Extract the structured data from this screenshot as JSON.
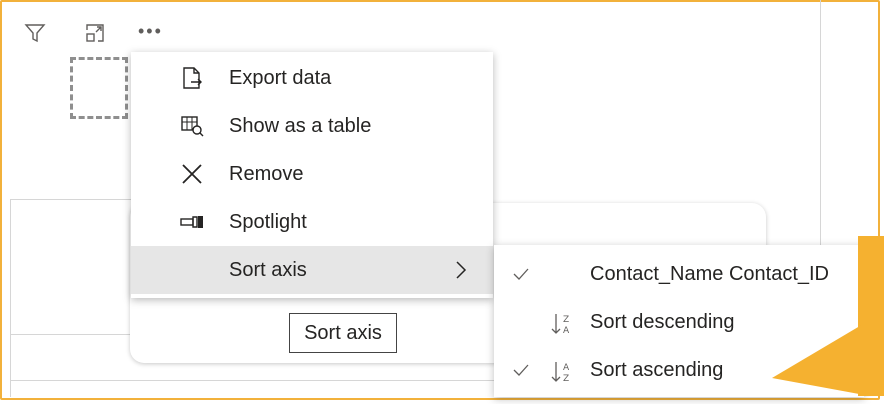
{
  "menu": {
    "items": [
      {
        "label": "Export data",
        "icon": "export-data-icon"
      },
      {
        "label": "Show as a table",
        "icon": "show-as-table-icon"
      },
      {
        "label": "Remove",
        "icon": "close-icon"
      },
      {
        "label": "Spotlight",
        "icon": "spotlight-icon"
      },
      {
        "label": "Sort axis",
        "icon": "",
        "active": true,
        "has_submenu": true
      }
    ]
  },
  "submenu": {
    "items": [
      {
        "label": "Contact_Name Contact_ID",
        "checked": true,
        "icon": ""
      },
      {
        "label": "Sort descending",
        "checked": false,
        "icon": "sort-descending-icon"
      },
      {
        "label": "Sort ascending",
        "checked": true,
        "icon": "sort-ascending-icon"
      }
    ]
  },
  "tooltip": {
    "text": "Sort axis"
  },
  "colors": {
    "frame": "#f2b13b",
    "arrow": "#f5b130",
    "menu_active": "#e6e6e6"
  }
}
